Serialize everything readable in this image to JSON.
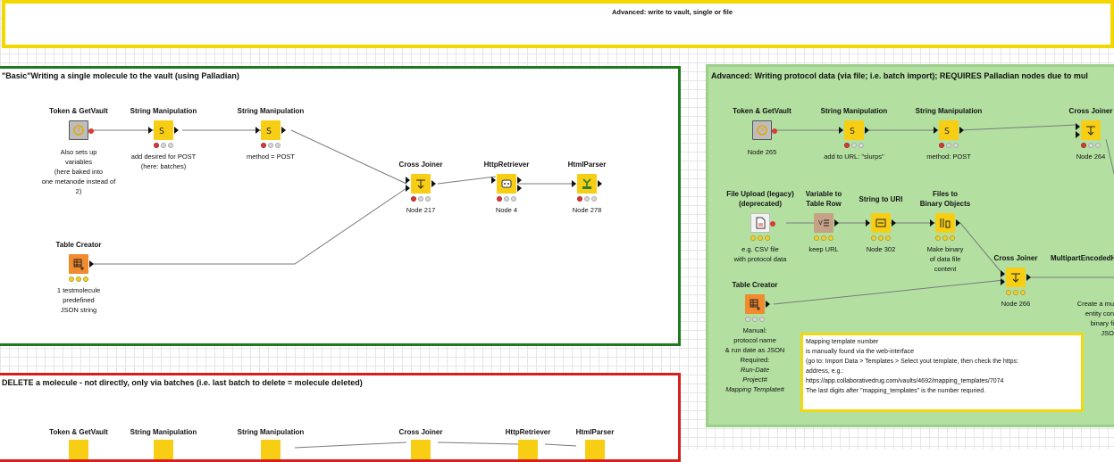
{
  "canvas": {
    "annotations": {
      "top": {
        "title": "Advanced: write to vault, single or file",
        "border": "#f2d800"
      },
      "basic": {
        "title": "\"Basic\"Writing a single molecule to the vault    (using Palladian)",
        "border": "#1d7a1d"
      },
      "advanced": {
        "title": "Advanced: Writing protocol data (via file; i.e. batch import); REQUIRES     Palladian nodes due to mul",
        "border": "#1d7a1d",
        "background": "#b3e0a1"
      },
      "delete": {
        "title": "DELETE  a molecule - not directly, only via batches (i.e. last batch to delete = molecule deleted)",
        "border": "#d62020"
      }
    },
    "basic_nodes": {
      "token": {
        "title": "Token & GetVault",
        "label": "Also sets up\nvariables\n(here baked into\none metanode instead of 2)",
        "icon": "metanode-icon"
      },
      "strman1": {
        "title": "String Manipulation",
        "label": "add desired for POST\n(here: batches)",
        "icon": "string-manipulation-icon"
      },
      "strman2": {
        "title": "String Manipulation",
        "label": "method = POST",
        "icon": "string-manipulation-icon"
      },
      "crossjoin": {
        "title": "Cross Joiner",
        "label": "Node 217",
        "icon": "cross-joiner-icon"
      },
      "http": {
        "title": "HttpRetriever",
        "label": "Node 4",
        "icon": "http-retriever-icon"
      },
      "html": {
        "title": "HtmlParser",
        "label": "Node 278",
        "icon": "html-parser-icon"
      },
      "tablecreator": {
        "title": "Table Creator",
        "label": "1 testmolecule\npredefined\nJSON string",
        "icon": "table-creator-icon"
      }
    },
    "advanced_nodes": {
      "token": {
        "title": "Token & GetVault",
        "label": "Node 265"
      },
      "strman1": {
        "title": "String Manipulation",
        "label": "add to URL: \"slurps\""
      },
      "strman2": {
        "title": "String Manipulation",
        "label": "method: POST"
      },
      "crossjoin1": {
        "title": "Cross Joiner",
        "label": "Node 264"
      },
      "fileupload": {
        "title": "File Upload (legacy)\n(deprecated)",
        "label": "e.g. CSV file\nwith protocol data"
      },
      "var2row": {
        "title": "Variable to\nTable Row",
        "label": "keep URL"
      },
      "str2uri": {
        "title": "String to URI",
        "label": "Node 302"
      },
      "files2bin": {
        "title": "Files to\nBinary Objects",
        "label": "Make binary\nof data file\ncontent"
      },
      "crossjoin2": {
        "title": "Cross Joiner",
        "label": "Node 266"
      },
      "multipart": {
        "title": "MultipartEncodedH",
        "label": "Create a mu\nentity con\nbinary fi\nJSO"
      },
      "tablecreator": {
        "title": "Table Creator",
        "label": "Manual:\nprotocol name\n& run date as JSON\nRequired:"
      },
      "required_italic": "Run-Date\nProject#\nMapping Template#"
    },
    "note": {
      "lines": [
        "Mapping template number",
        "is manually found via the web-interface",
        "(go to: Import Data > Templates > Select yout template, then check the https:",
        "address, e.g.:",
        "https://app.collaborativedrug.com/vaults/4692/mapping_templates/7074",
        "The last digits after \"mapping_templates\" is the number requried."
      ]
    },
    "delete_nodes": {
      "token": {
        "title": "Token & GetVault"
      },
      "strman1": {
        "title": "String Manipulation"
      },
      "strman2": {
        "title": "String Manipulation"
      },
      "crossjoin": {
        "title": "Cross Joiner"
      },
      "http": {
        "title": "HttpRetriever"
      },
      "html": {
        "title": "HtmlParser"
      }
    }
  }
}
